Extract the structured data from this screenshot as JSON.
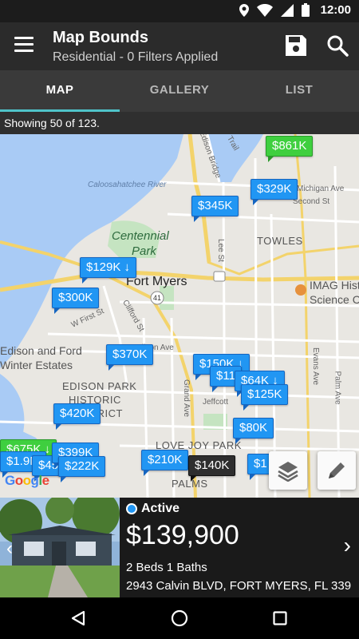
{
  "status_bar": {
    "time": "12:00"
  },
  "app_bar": {
    "title": "Map Bounds",
    "subtitle": "Residential - 0 Filters Applied"
  },
  "tabs": [
    {
      "label": "MAP",
      "active": true
    },
    {
      "label": "GALLERY",
      "active": false
    },
    {
      "label": "LIST",
      "active": false
    }
  ],
  "showing": "Showing 50 of 123.",
  "map": {
    "labels": {
      "edison_bridge": "Edison Bridge",
      "trail": "Trail",
      "river": "Caloosahatchee River",
      "centennial": "Centennial",
      "park": "Park",
      "fort_myers": "Fort Myers",
      "michigan": "Michigan Ave",
      "second": "Second St",
      "towles": "TOWLES",
      "lee": "Lee St",
      "imag": "IMAG History &",
      "science": "Science Center",
      "first": "W First St",
      "clifford": "Clifford St",
      "edison_ford": "Edison and Ford",
      "winter": "Winter Estates",
      "edison_park_1": "EDISON PARK",
      "edison_park_2": "HISTORIC",
      "edison_park_3": "DISTRICT",
      "edison_ave": "Edison Ave",
      "grand": "Grand Ave",
      "jeffcott": "Jeffcott",
      "love_joy": "LOVE JOY PARK",
      "palms": "PALMS",
      "evans": "Evans Ave",
      "palm": "Palm Ave",
      "route": "41"
    },
    "pins": [
      {
        "label": "$861K",
        "color": "green"
      },
      {
        "label": "$329K",
        "color": "blue"
      },
      {
        "label": "$345K",
        "color": "blue"
      },
      {
        "label": "$129K ↓",
        "color": "blue"
      },
      {
        "label": "$300K",
        "color": "blue"
      },
      {
        "label": "$370K",
        "color": "blue"
      },
      {
        "label": "$150K ↓",
        "color": "blue"
      },
      {
        "label": "$11",
        "color": "blue"
      },
      {
        "label": "$64K ↓",
        "color": "blue"
      },
      {
        "label": "$125K",
        "color": "blue"
      },
      {
        "label": "$420K",
        "color": "blue"
      },
      {
        "label": "$80K",
        "color": "blue"
      },
      {
        "label": "$675K ↓",
        "color": "green"
      },
      {
        "label": "$1.9M",
        "color": "blue"
      },
      {
        "label": "$45",
        "color": "blue"
      },
      {
        "label": "$399K",
        "color": "blue"
      },
      {
        "label": "$222K",
        "color": "blue"
      },
      {
        "label": "$210K",
        "color": "blue"
      },
      {
        "label": "$140K",
        "color": "dark"
      },
      {
        "label": "$1",
        "color": "blue"
      }
    ],
    "google_logo": "Google"
  },
  "listing": {
    "status": "Active",
    "price": "$139,900",
    "beds_baths": "2 Beds 1 Baths",
    "address": "2943 Calvin BLVD, FORT MYERS, FL 339..."
  },
  "icons": {
    "menu": "hamburger-menu-icon",
    "save": "save-icon",
    "search": "search-icon",
    "layers": "layers-icon",
    "pencil": "pencil-icon",
    "back": "back-triangle-icon",
    "home": "home-circle-icon",
    "recents": "recents-square-icon"
  }
}
